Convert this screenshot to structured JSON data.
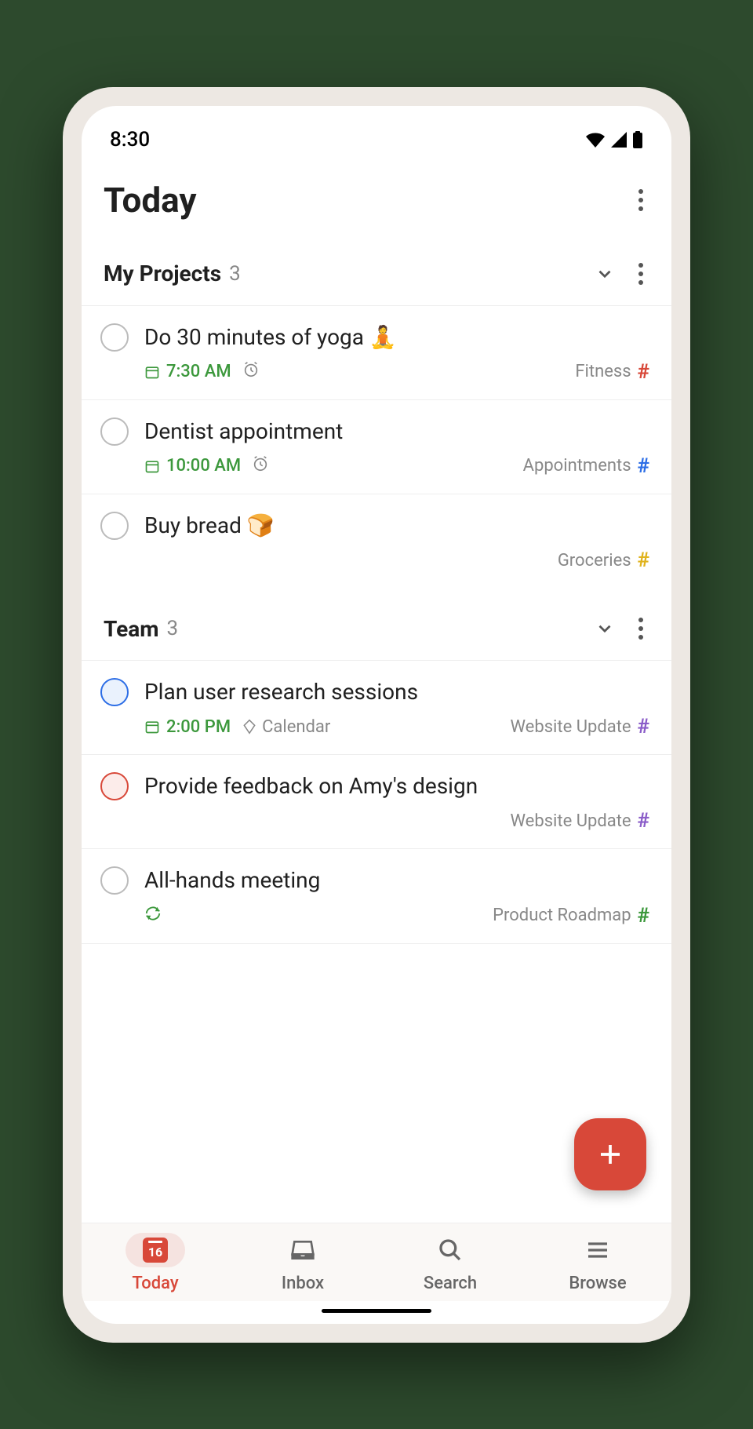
{
  "status": {
    "time": "8:30"
  },
  "header": {
    "title": "Today"
  },
  "sections": [
    {
      "title": "My Projects",
      "count": "3",
      "tasks": [
        {
          "title": "Do 30 minutes of yoga 🧘",
          "time": "7:30 AM",
          "alarm": true,
          "project": "Fitness",
          "hash_color": "red",
          "priority": "none"
        },
        {
          "title": "Dentist appointment",
          "time": "10:00 AM",
          "alarm": true,
          "project": "Appointments",
          "hash_color": "blue",
          "priority": "none"
        },
        {
          "title": "Buy bread 🍞",
          "project": "Groceries",
          "hash_color": "yellow",
          "priority": "none"
        }
      ]
    },
    {
      "title": "Team",
      "count": "3",
      "tasks": [
        {
          "title": "Plan user research sessions",
          "time": "2:00 PM",
          "label": "Calendar",
          "project": "Website Update",
          "hash_color": "purple",
          "priority": "blue"
        },
        {
          "title": "Provide feedback on Amy's design",
          "project": "Website Update",
          "hash_color": "purple",
          "priority": "red"
        },
        {
          "title": "All-hands meeting",
          "recurring": true,
          "project": "Product Roadmap",
          "hash_color": "green",
          "priority": "none"
        }
      ]
    }
  ],
  "nav": {
    "today": "Today",
    "today_date": "16",
    "inbox": "Inbox",
    "search": "Search",
    "browse": "Browse"
  }
}
